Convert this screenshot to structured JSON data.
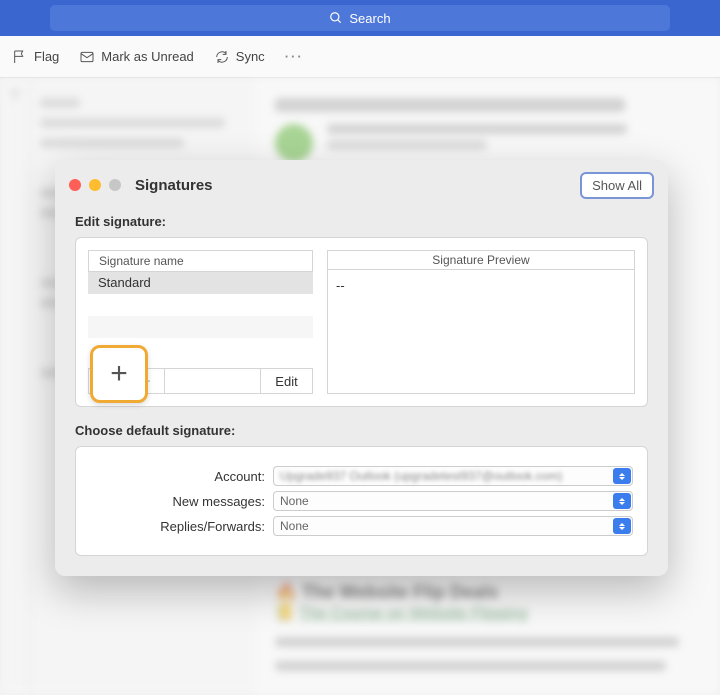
{
  "topbar": {
    "search_placeholder": "Search"
  },
  "toolbar": {
    "flag": "Flag",
    "unread": "Mark as Unread",
    "sync": "Sync",
    "more": "···"
  },
  "bg": {
    "deal_heading": "🔥 The Website Flip Deals",
    "course_link": "The Course on Website Flipping"
  },
  "modal": {
    "title": "Signatures",
    "show_all": "Show All",
    "edit_label": "Edit signature:",
    "sig_name_header": "Signature name",
    "signatures": [
      "Standard"
    ],
    "edit_btn": "Edit",
    "preview_header": "Signature Preview",
    "preview_body": "--",
    "choose_label": "Choose default signature:",
    "fields": {
      "account_label": "Account:",
      "account_value": "Upgrade937 Outlook (upgradetest937@outlook.com)",
      "new_label": "New messages:",
      "new_value": "None",
      "reply_label": "Replies/Forwards:",
      "reply_value": "None"
    }
  }
}
